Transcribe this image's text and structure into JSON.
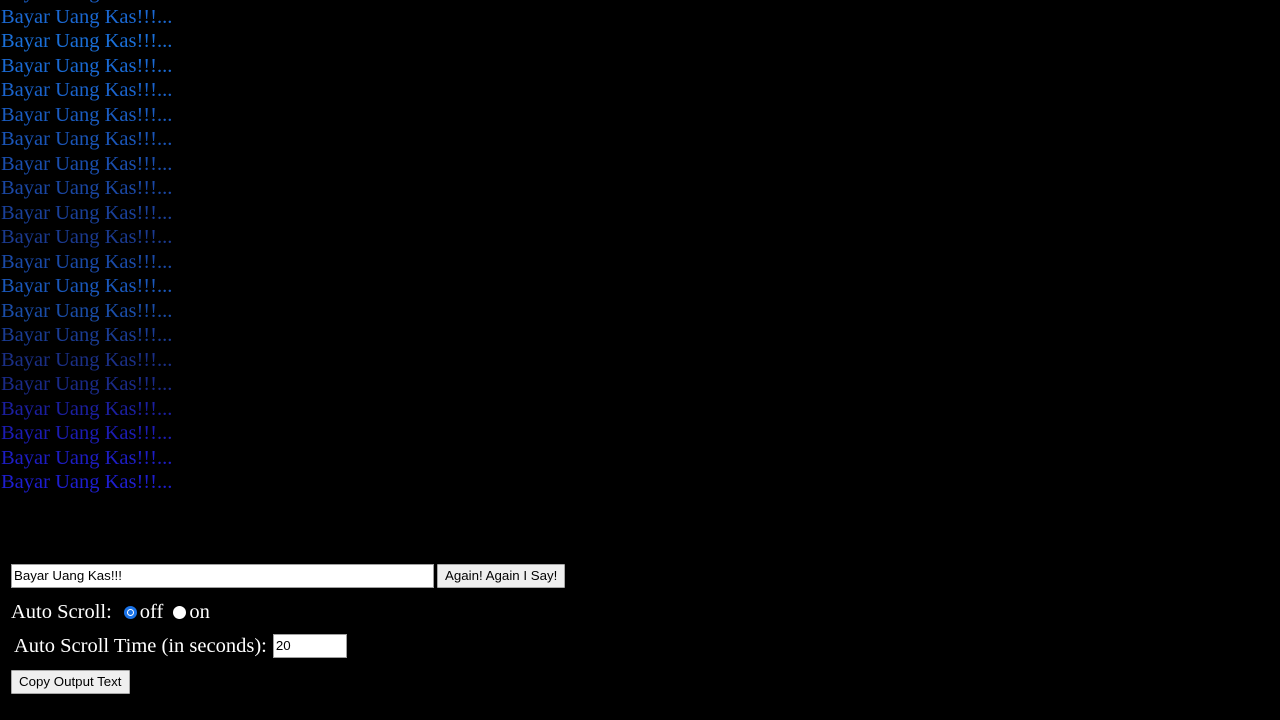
{
  "page": {
    "background_color": "#000000",
    "text_color": "#ffffff"
  },
  "output": {
    "message": "Bayar Uang Kas!!!...",
    "line_count": 20,
    "lines": [
      {
        "text": "Bayar Uang Kas!!!...",
        "color": "#1a5fc8"
      },
      {
        "text": "Bayar Uang Kas!!!...",
        "color": "#1a68d2"
      },
      {
        "text": "Bayar Uang Kas!!!...",
        "color": "#1a6fd8"
      },
      {
        "text": "Bayar Uang Kas!!!...",
        "color": "#1a6ad4"
      },
      {
        "text": "Bayar Uang Kas!!!...",
        "color": "#1a63cc"
      },
      {
        "text": "Bayar Uang Kas!!!...",
        "color": "#1a5cc2"
      },
      {
        "text": "Bayar Uang Kas!!!...",
        "color": "#1a55b8"
      },
      {
        "text": "Bayar Uang Kas!!!...",
        "color": "#1a4eae"
      },
      {
        "text": "Bayar Uang Kas!!!...",
        "color": "#1a47a4"
      },
      {
        "text": "Bayar Uang Kas!!!...",
        "color": "#1a409a"
      },
      {
        "text": "Bayar Uang Kas!!!...",
        "color": "#1a3a90"
      },
      {
        "text": "Bayar Uang Kas!!!...",
        "color": "#1a4aa8"
      },
      {
        "text": "Bayar Uang Kas!!!...",
        "color": "#1a58bc"
      },
      {
        "text": "Bayar Uang Kas!!!...",
        "color": "#1a4da8"
      },
      {
        "text": "Bayar Uang Kas!!!...",
        "color": "#1a3c94"
      },
      {
        "text": "Bayar Uang Kas!!!...",
        "color": "#1a2f86"
      },
      {
        "text": "Bayar Uang Kas!!!...",
        "color": "#1a2a88"
      },
      {
        "text": "Bayar Uang Kas!!!...",
        "color": "#1b1fa0"
      },
      {
        "text": "Bayar Uang Kas!!!...",
        "color": "#1c1cb4"
      },
      {
        "text": "Bayar Uang Kas!!!...",
        "color": "#1d1dc4"
      },
      {
        "text": "Bayar Uang Kas!!!...",
        "color": "#1e1ed0"
      }
    ]
  },
  "controls": {
    "text_input": {
      "value": "Bayar Uang Kas!!!",
      "placeholder": ""
    },
    "again_button_label": "Again! Again I Say!",
    "auto_scroll": {
      "label": "Auto Scroll:",
      "options": [
        {
          "label": "off",
          "value": "off",
          "checked": true
        },
        {
          "label": "on",
          "value": "on",
          "checked": false
        }
      ],
      "selected": "off",
      "accent_color": "#1a73e8"
    },
    "auto_scroll_time": {
      "label": "Auto Scroll Time (in seconds):",
      "value": "20"
    },
    "copy_button_label": "Copy Output Text"
  }
}
